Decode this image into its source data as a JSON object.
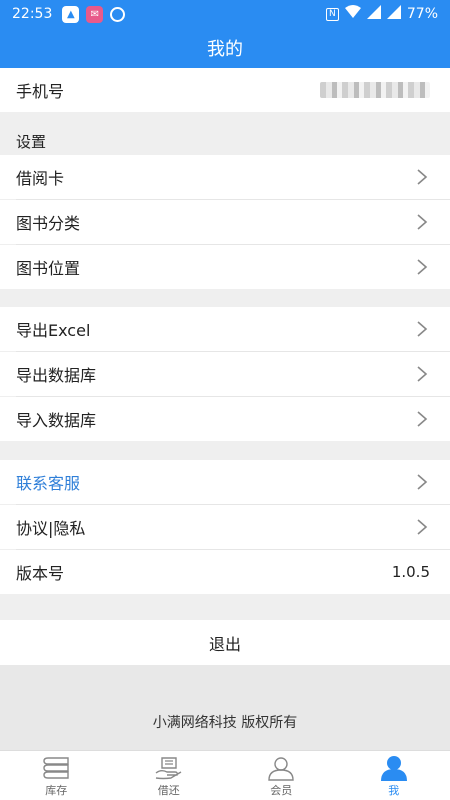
{
  "status_bar": {
    "time": "22:53",
    "battery": "77%"
  },
  "header": {
    "title": "我的"
  },
  "account": {
    "phone_label": "手机号"
  },
  "settings_section": {
    "title": "设置",
    "items": [
      {
        "label": "借阅卡"
      },
      {
        "label": "图书分类"
      },
      {
        "label": "图书位置"
      }
    ]
  },
  "data_section": {
    "items": [
      {
        "label": "导出Excel"
      },
      {
        "label": "导出数据库"
      },
      {
        "label": "导入数据库"
      }
    ]
  },
  "about_section": {
    "items": [
      {
        "label": "联系客服"
      },
      {
        "label": "协议|隐私"
      }
    ],
    "version_label": "版本号",
    "version_value": "1.0.5"
  },
  "logout_label": "退出",
  "copyright": "小满网络科技 版权所有",
  "tabs": [
    {
      "label": "库存",
      "icon": "books-icon",
      "active": false
    },
    {
      "label": "借还",
      "icon": "hand-book-icon",
      "active": false
    },
    {
      "label": "会员",
      "icon": "user-outline-icon",
      "active": false
    },
    {
      "label": "我",
      "icon": "user-filled-icon",
      "active": true
    }
  ],
  "colors": {
    "primary": "#2a8cf2",
    "link": "#2f7fd8",
    "background": "#efefef"
  }
}
